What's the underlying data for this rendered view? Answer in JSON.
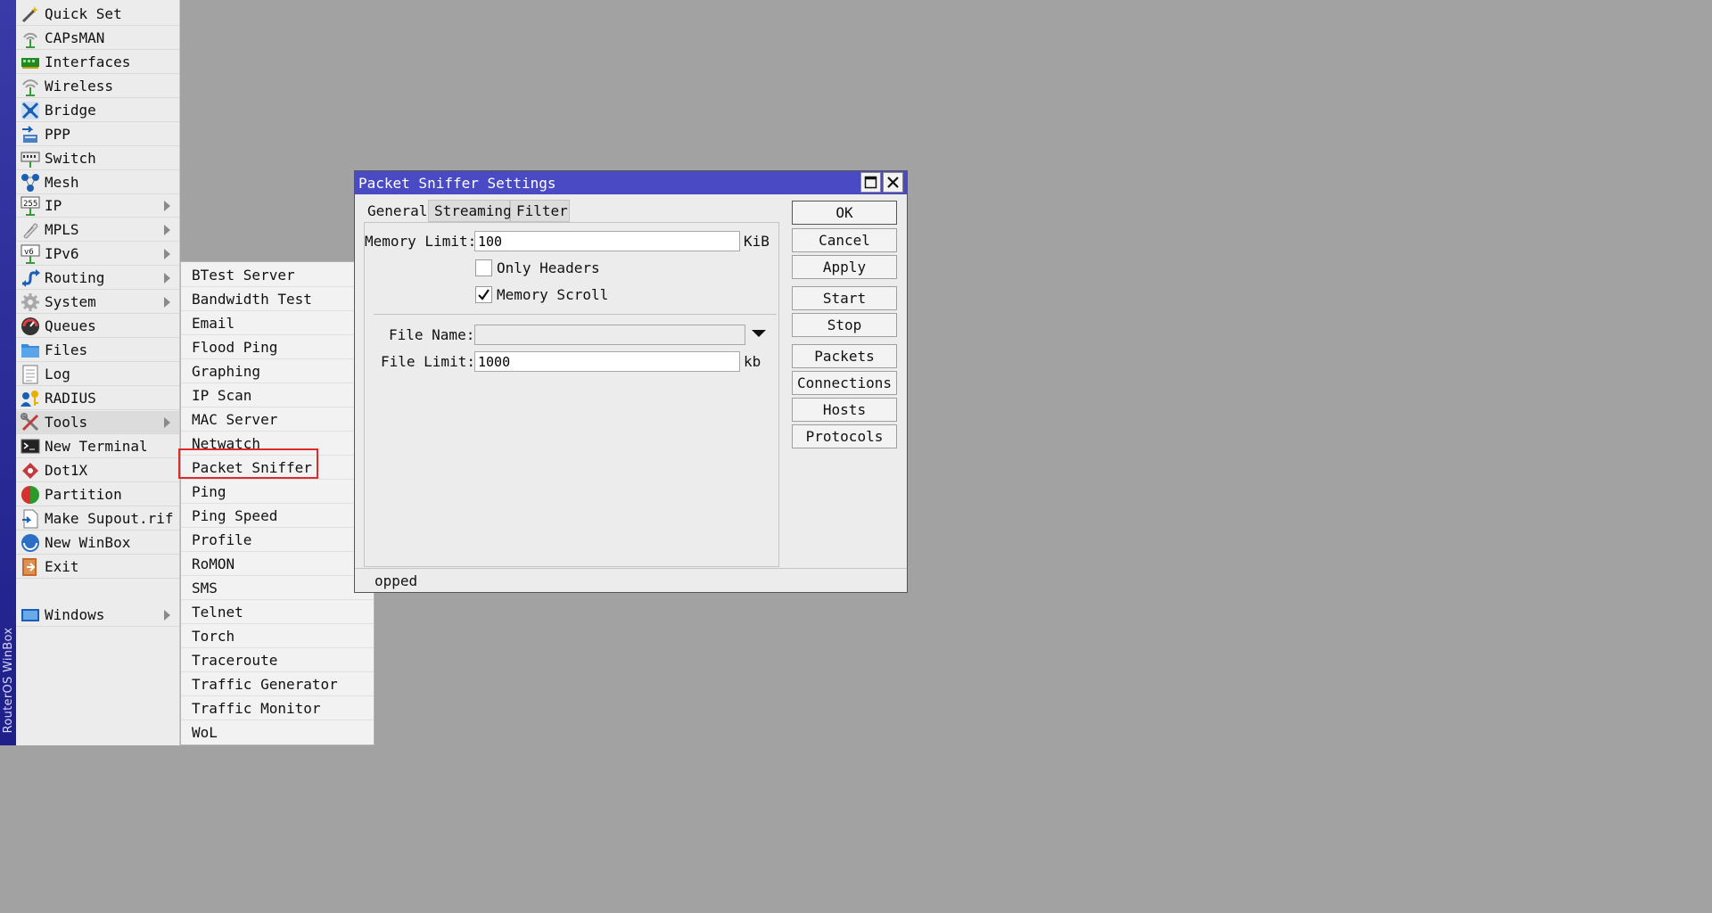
{
  "brand": {
    "text": "RouterOS WinBox"
  },
  "main_menu": {
    "items": [
      {
        "label": "Quick Set",
        "icon": "wand-icon",
        "submenu": false
      },
      {
        "label": "CAPsMAN",
        "icon": "antenna-icon",
        "submenu": false
      },
      {
        "label": "Interfaces",
        "icon": "network-card-icon",
        "submenu": false
      },
      {
        "label": "Wireless",
        "icon": "wireless-icon",
        "submenu": false
      },
      {
        "label": "Bridge",
        "icon": "bridge-icon",
        "submenu": false
      },
      {
        "label": "PPP",
        "icon": "ppp-icon",
        "submenu": false
      },
      {
        "label": "Switch",
        "icon": "switch-icon",
        "submenu": false
      },
      {
        "label": "Mesh",
        "icon": "mesh-icon",
        "submenu": false
      },
      {
        "label": "IP",
        "icon": "ip-icon",
        "submenu": true
      },
      {
        "label": "MPLS",
        "icon": "mpls-icon",
        "submenu": true
      },
      {
        "label": "IPv6",
        "icon": "ipv6-icon",
        "submenu": true
      },
      {
        "label": "Routing",
        "icon": "routing-icon",
        "submenu": true
      },
      {
        "label": "System",
        "icon": "gear-icon",
        "submenu": true
      },
      {
        "label": "Queues",
        "icon": "queues-icon",
        "submenu": false
      },
      {
        "label": "Files",
        "icon": "folder-icon",
        "submenu": false
      },
      {
        "label": "Log",
        "icon": "log-icon",
        "submenu": false
      },
      {
        "label": "RADIUS",
        "icon": "radius-icon",
        "submenu": false
      },
      {
        "label": "Tools",
        "icon": "tools-icon",
        "submenu": true,
        "active": true
      },
      {
        "label": "New Terminal",
        "icon": "terminal-icon",
        "submenu": false
      },
      {
        "label": "Dot1X",
        "icon": "dot1x-icon",
        "submenu": false
      },
      {
        "label": "Partition",
        "icon": "partition-icon",
        "submenu": false
      },
      {
        "label": "Make Supout.rif",
        "icon": "supout-icon",
        "submenu": false
      },
      {
        "label": "New WinBox",
        "icon": "winbox-icon",
        "submenu": false
      },
      {
        "label": "Exit",
        "icon": "exit-icon",
        "submenu": false
      }
    ],
    "windows_item": {
      "label": "Windows",
      "icon": "windows-icon",
      "submenu": true
    }
  },
  "tools_submenu": {
    "items": [
      "BTest Server",
      "Bandwidth Test",
      "Email",
      "Flood Ping",
      "Graphing",
      "IP Scan",
      "MAC Server",
      "Netwatch",
      "Packet Sniffer",
      "Ping",
      "Ping Speed",
      "Profile",
      "RoMON",
      "SMS",
      "Telnet",
      "Torch",
      "Traceroute",
      "Traffic Generator",
      "Traffic Monitor",
      "WoL"
    ],
    "highlighted": "Packet Sniffer"
  },
  "dialog": {
    "title": "Packet Sniffer Settings",
    "tabs": [
      "General",
      "Streaming",
      "Filter"
    ],
    "selected_tab": "General",
    "memory_limit": {
      "label": "Memory Limit:",
      "value": "100",
      "unit": "KiB"
    },
    "only_headers": {
      "label": "Only Headers",
      "checked": false
    },
    "memory_scroll": {
      "label": "Memory Scroll",
      "checked": true
    },
    "file_name": {
      "label": "File Name:",
      "value": ""
    },
    "file_limit": {
      "label": "File Limit:",
      "value": "1000",
      "unit": "kb"
    },
    "buttons": {
      "ok": "OK",
      "cancel": "Cancel",
      "apply": "Apply",
      "start": "Start",
      "stop": "Stop",
      "packets": "Packets",
      "connections": "Connections",
      "hosts": "Hosts",
      "protocols": "Protocols"
    },
    "status": "opped"
  },
  "colors": {
    "desktop": "#a2a2a2",
    "titlebar": "#4a4ac4",
    "brand_strip": "#2b2b9a",
    "highlight": "#dd2a2a"
  }
}
